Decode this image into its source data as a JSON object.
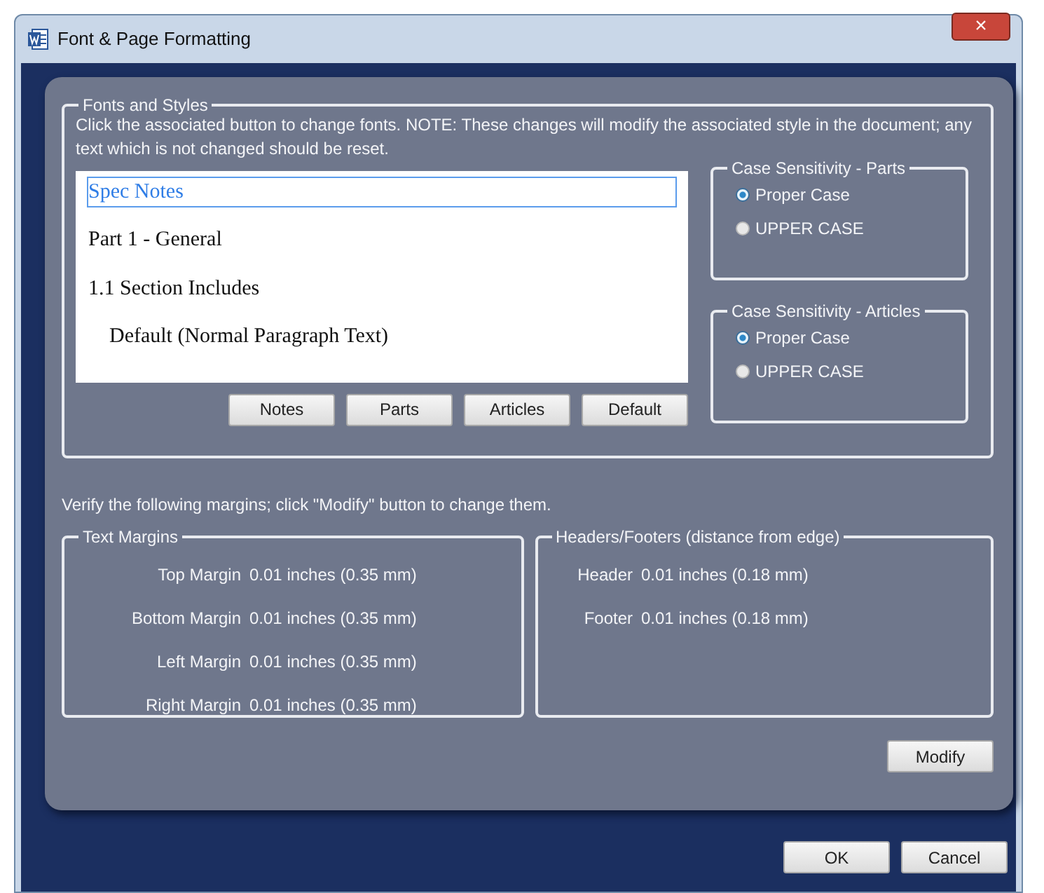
{
  "window": {
    "title": "Font & Page Formatting",
    "close": "×"
  },
  "fonts_and_styles": {
    "title": "Fonts and Styles",
    "instructions": "Click the associated button to change fonts.  NOTE:  These changes will modify the associated style in the document; any text which is not changed should be reset.",
    "styles": [
      {
        "label": "Spec Notes",
        "kind": "notes",
        "selected": true
      },
      {
        "label": "Part 1 - General",
        "kind": "part",
        "selected": false
      },
      {
        "label": "1.1 Section Includes",
        "kind": "article",
        "selected": false
      },
      {
        "label": "Default (Normal Paragraph Text)",
        "kind": "default",
        "selected": false
      }
    ],
    "buttons": [
      "Notes",
      "Parts",
      "Articles",
      "Default"
    ],
    "case_groups": [
      {
        "title": "Case Sensitivity - Parts",
        "options": [
          {
            "label": "Proper Case",
            "selected": true
          },
          {
            "label": "UPPER CASE",
            "selected": false
          }
        ]
      },
      {
        "title": "Case Sensitivity - Articles",
        "options": [
          {
            "label": "Proper Case",
            "selected": true
          },
          {
            "label": "UPPER CASE",
            "selected": false
          }
        ]
      }
    ]
  },
  "margins_note": "Verify the following margins;  click \"Modify\" button to change them.",
  "margin_groups": [
    {
      "title": "Text Margins",
      "rows": [
        {
          "label": "Top Margin",
          "value": "0.01 inches (0.35 mm)"
        },
        {
          "label": "Bottom Margin",
          "value": "0.01 inches (0.35 mm)"
        },
        {
          "label": "Left Margin",
          "value": "0.01 inches (0.35 mm)"
        },
        {
          "label": "Right Margin",
          "value": "0.01 inches (0.35 mm)"
        }
      ]
    },
    {
      "title": "Headers/Footers (distance from edge)",
      "rows": [
        {
          "label": "Header",
          "value": "0.01 inches (0.18 mm)"
        },
        {
          "label": "Footer",
          "value": "0.01 inches (0.18 mm)"
        }
      ]
    }
  ],
  "modify_button": "Modify",
  "dialog_buttons": [
    "OK",
    "Cancel"
  ]
}
